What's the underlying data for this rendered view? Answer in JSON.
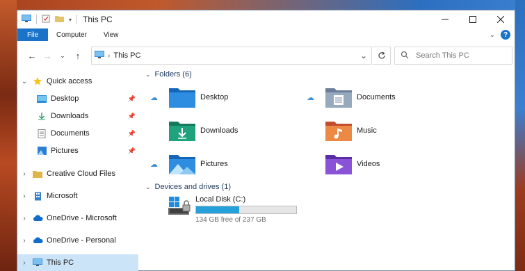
{
  "window": {
    "title": "This PC"
  },
  "ribbon": {
    "tabs": [
      "File",
      "Computer",
      "View"
    ],
    "help": "?"
  },
  "address": {
    "path": "This PC",
    "search_placeholder": "Search This PC"
  },
  "nav": {
    "quick_access": "Quick access",
    "pinned": [
      "Desktop",
      "Downloads",
      "Documents",
      "Pictures"
    ],
    "items": [
      "Creative Cloud Files",
      "Microsoft",
      "OneDrive - Microsoft",
      "OneDrive - Personal",
      "This PC"
    ]
  },
  "folders": {
    "header": "Folders (6)",
    "items": [
      "Desktop",
      "Documents",
      "Downloads",
      "Music",
      "Pictures",
      "Videos"
    ]
  },
  "devices": {
    "header": "Devices and drives (1)",
    "drive_name": "Local Disk (C:)",
    "free_text": "134 GB free of 237 GB",
    "used_fraction": 0.43
  },
  "colors": {
    "accent": "#1a73c8",
    "selection": "#cce4f7",
    "progress": "#26a0da"
  }
}
